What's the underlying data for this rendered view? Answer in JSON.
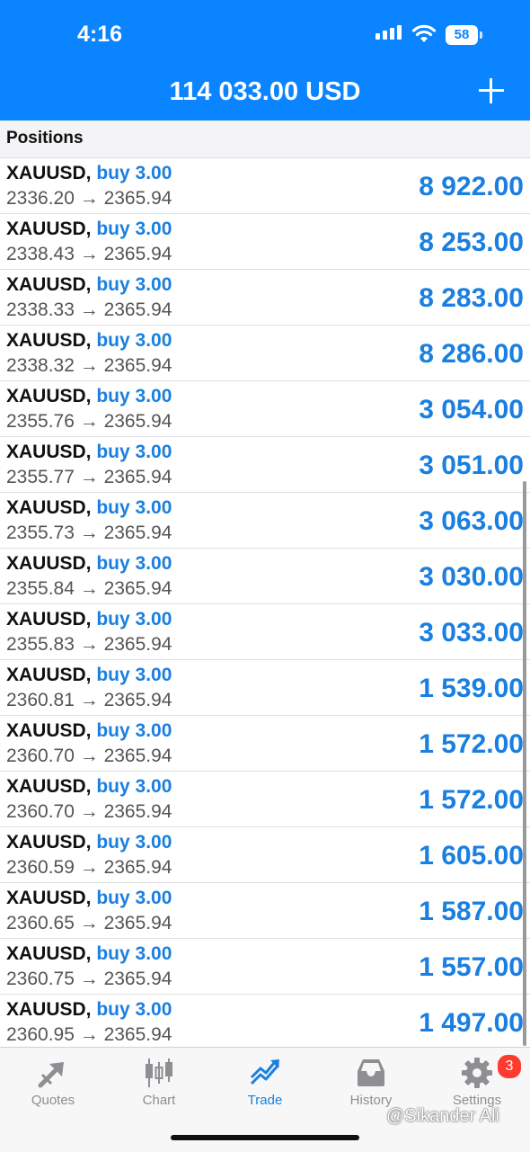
{
  "status_bar": {
    "time": "4:16",
    "battery": "58"
  },
  "header": {
    "balance": "114 033.00 USD"
  },
  "section": {
    "title": "Positions"
  },
  "positions": [
    {
      "symbol": "XAUUSD,",
      "side": "buy 3.00",
      "prices": "2336.20 → 2365.94",
      "profit": "8 922.00"
    },
    {
      "symbol": "XAUUSD,",
      "side": "buy 3.00",
      "prices": "2338.43 → 2365.94",
      "profit": "8 253.00"
    },
    {
      "symbol": "XAUUSD,",
      "side": "buy 3.00",
      "prices": "2338.33 → 2365.94",
      "profit": "8 283.00"
    },
    {
      "symbol": "XAUUSD,",
      "side": "buy 3.00",
      "prices": "2338.32 → 2365.94",
      "profit": "8 286.00"
    },
    {
      "symbol": "XAUUSD,",
      "side": "buy 3.00",
      "prices": "2355.76 → 2365.94",
      "profit": "3 054.00"
    },
    {
      "symbol": "XAUUSD,",
      "side": "buy 3.00",
      "prices": "2355.77 → 2365.94",
      "profit": "3 051.00"
    },
    {
      "symbol": "XAUUSD,",
      "side": "buy 3.00",
      "prices": "2355.73 → 2365.94",
      "profit": "3 063.00"
    },
    {
      "symbol": "XAUUSD,",
      "side": "buy 3.00",
      "prices": "2355.84 → 2365.94",
      "profit": "3 030.00"
    },
    {
      "symbol": "XAUUSD,",
      "side": "buy 3.00",
      "prices": "2355.83 → 2365.94",
      "profit": "3 033.00"
    },
    {
      "symbol": "XAUUSD,",
      "side": "buy 3.00",
      "prices": "2360.81 → 2365.94",
      "profit": "1 539.00"
    },
    {
      "symbol": "XAUUSD,",
      "side": "buy 3.00",
      "prices": "2360.70 → 2365.94",
      "profit": "1 572.00"
    },
    {
      "symbol": "XAUUSD,",
      "side": "buy 3.00",
      "prices": "2360.70 → 2365.94",
      "profit": "1 572.00"
    },
    {
      "symbol": "XAUUSD,",
      "side": "buy 3.00",
      "prices": "2360.59 → 2365.94",
      "profit": "1 605.00"
    },
    {
      "symbol": "XAUUSD,",
      "side": "buy 3.00",
      "prices": "2360.65 → 2365.94",
      "profit": "1 587.00"
    },
    {
      "symbol": "XAUUSD,",
      "side": "buy 3.00",
      "prices": "2360.75 → 2365.94",
      "profit": "1 557.00"
    },
    {
      "symbol": "XAUUSD,",
      "side": "buy 3.00",
      "prices": "2360.95 → 2365.94",
      "profit": "1 497.00"
    }
  ],
  "tabs": [
    {
      "label": "Quotes",
      "icon": "quotes-icon"
    },
    {
      "label": "Chart",
      "icon": "chart-icon"
    },
    {
      "label": "Trade",
      "icon": "trade-icon",
      "active": true
    },
    {
      "label": "History",
      "icon": "history-icon"
    },
    {
      "label": "Settings",
      "icon": "gear-icon",
      "badge": "3"
    }
  ],
  "colors": {
    "accent": "#0a84ff",
    "profit": "#1a7fe0",
    "badge": "#ff3b30"
  },
  "watermark": "@Sikander Ali"
}
